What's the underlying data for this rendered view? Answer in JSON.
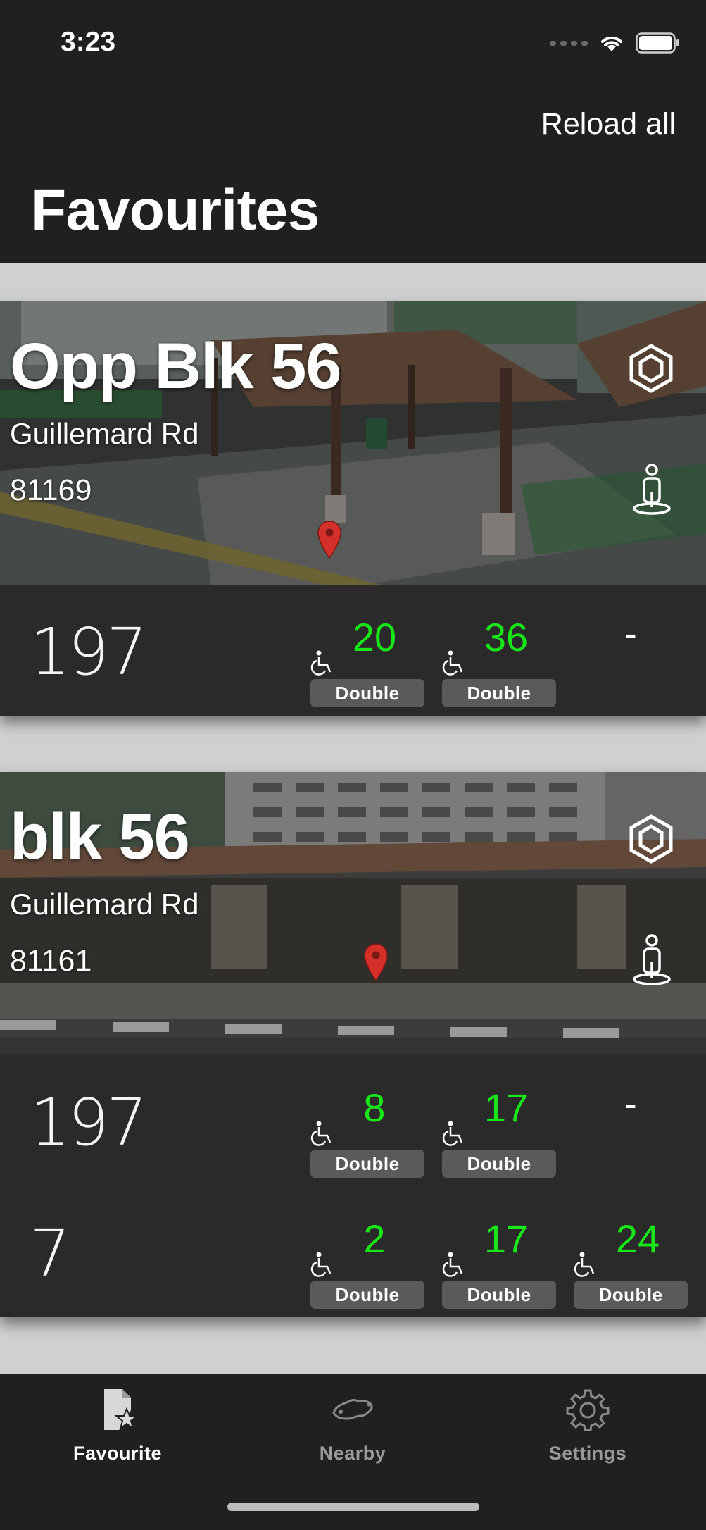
{
  "status_bar": {
    "time": "3:23"
  },
  "header": {
    "reload_label": "Reload all",
    "title": "Favourites"
  },
  "cards": [
    {
      "name": "Opp Blk 56",
      "road": "Guillemard Rd",
      "code": "81169",
      "services": [
        {
          "number": "197",
          "arrivals": [
            {
              "mins": "20",
              "type": "Double"
            },
            {
              "mins": "36",
              "type": "Double"
            },
            {
              "empty": "-"
            }
          ]
        }
      ]
    },
    {
      "name": "blk 56",
      "road": "Guillemard Rd",
      "code": "81161",
      "services": [
        {
          "number": "197",
          "arrivals": [
            {
              "mins": "8",
              "type": "Double"
            },
            {
              "mins": "17",
              "type": "Double"
            },
            {
              "empty": "-"
            }
          ]
        },
        {
          "number": "7",
          "arrivals": [
            {
              "mins": "2",
              "type": "Double"
            },
            {
              "mins": "17",
              "type": "Double"
            },
            {
              "mins": "24",
              "type": "Double"
            }
          ]
        }
      ]
    }
  ],
  "tabs": [
    {
      "label": "Favourite",
      "icon": "favourite-star-icon",
      "active": true
    },
    {
      "label": "Nearby",
      "icon": "map-icon",
      "active": false
    },
    {
      "label": "Settings",
      "icon": "gear-icon",
      "active": false
    }
  ],
  "colors": {
    "arrival_green": "#19e619",
    "background": "#202020",
    "card": "#2a2a2a",
    "badge": "#5a5a5a"
  }
}
